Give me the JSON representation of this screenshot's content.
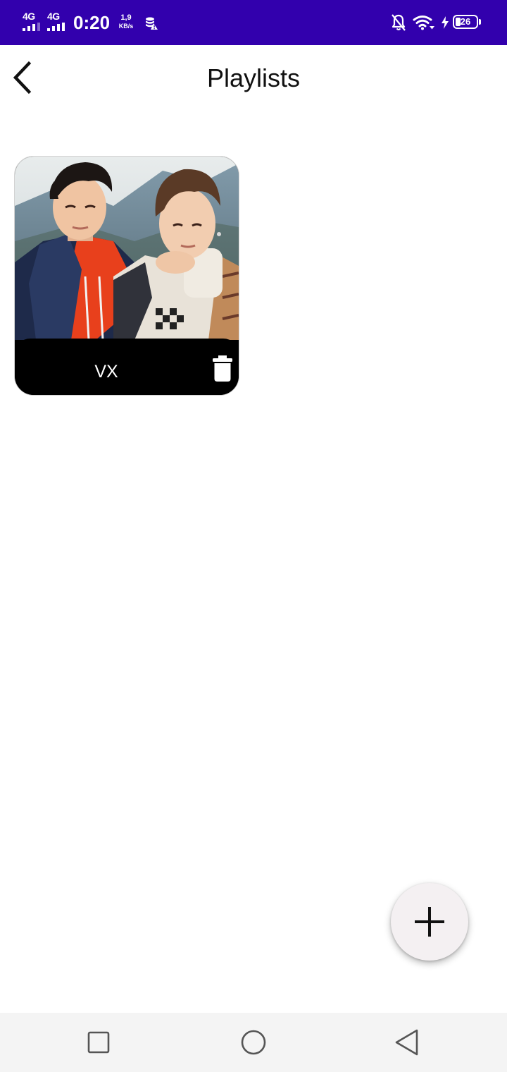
{
  "status_bar": {
    "sim1_network": "4G",
    "sim2_network": "4G",
    "time": "0:20",
    "speed_value": "1,9",
    "speed_unit": "KB/s",
    "battery_level": "26",
    "background_color": "#3200ad",
    "icons": [
      "signal-icon",
      "data-saver-icon",
      "notifications-off-icon",
      "wifi-icon",
      "charging-icon",
      "battery-icon"
    ]
  },
  "header": {
    "title": "Playlists",
    "back_icon": "chevron-left-icon"
  },
  "playlists": [
    {
      "name": "VX",
      "cover": "photo of two young men posing outdoors",
      "delete_icon": "trash-icon"
    }
  ],
  "fab": {
    "icon": "plus-icon"
  },
  "nav_bar": {
    "icons": [
      "recent-apps-icon",
      "home-icon",
      "back-icon"
    ]
  }
}
